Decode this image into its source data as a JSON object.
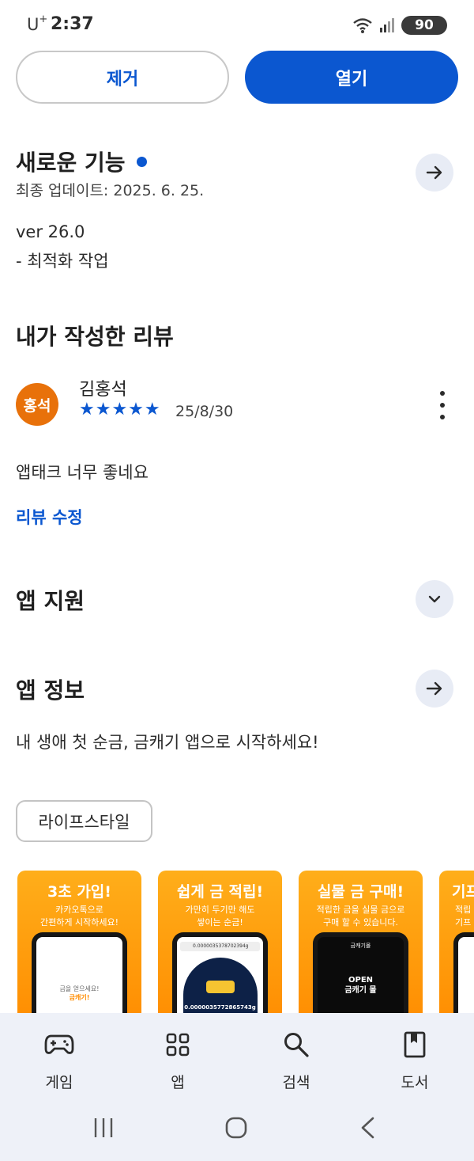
{
  "status_bar": {
    "carrier": "U",
    "carrier_sup": "+",
    "time": "2:37",
    "battery": "90"
  },
  "actions": {
    "remove_label": "제거",
    "open_label": "열기"
  },
  "whats_new": {
    "title": "새로운 기능",
    "last_updated": "최종 업데이트: 2025. 6. 25.",
    "version": "ver 26.0",
    "note": "- 최적화 작업"
  },
  "my_review": {
    "title": "내가 작성한 리뷰",
    "avatar_text": "홍석",
    "avatar_color": "#e8710a",
    "reviewer": "김홍석",
    "stars": "★★★★★",
    "rating": 5,
    "date": "25/8/30",
    "text": "앱태크 너무 좋네요",
    "edit_label": "리뷰 수정"
  },
  "app_support": {
    "title": "앱 지원"
  },
  "app_info": {
    "title": "앱 정보",
    "description": "내 생애 첫 순금, 금캐기 앱으로 시작하세요!",
    "category_chip": "라이프스타일"
  },
  "screenshots": [
    {
      "title": "3초 가입!",
      "subtitle": "카카오톡으로\n간편하게 시작하세요!",
      "screen_text": "금을 얻으세요!",
      "screen_highlight": "금캐기!"
    },
    {
      "title": "쉽게 금 적립!",
      "subtitle": "가만히 두기만 해도\n쌓이는 순금!",
      "screen_bar": "0.0000035378702394g",
      "screen_amount": "0.0000035772865743g"
    },
    {
      "title": "실물 금 구매!",
      "subtitle": "적립한 금을 실물 금으로\n구매 할 수 있습니다.",
      "screen_header": "금캐기몰",
      "screen_text": "OPEN\n금캐기 몰"
    },
    {
      "title": "기프",
      "subtitle": "적립\n기프"
    }
  ],
  "bottom_nav": {
    "items": [
      {
        "label": "게임",
        "icon": "gamepad-icon"
      },
      {
        "label": "앱",
        "icon": "apps-grid-icon"
      },
      {
        "label": "검색",
        "icon": "search-icon"
      },
      {
        "label": "도서",
        "icon": "book-icon"
      }
    ]
  },
  "colors": {
    "accent": "#0b57d0",
    "nav_bg": "#eef1f8",
    "screenshot_orange": "#ff9a00"
  }
}
